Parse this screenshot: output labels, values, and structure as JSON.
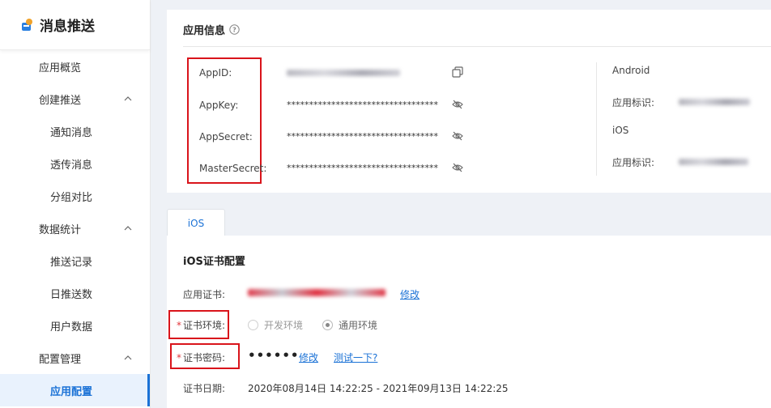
{
  "sidebar": {
    "title": "消息推送",
    "items": [
      {
        "label": "应用概览",
        "level": "top",
        "chevron": false
      },
      {
        "label": "创建推送",
        "level": "top",
        "chevron": true
      },
      {
        "label": "通知消息",
        "level": "sub",
        "chevron": false
      },
      {
        "label": "透传消息",
        "level": "sub",
        "chevron": false
      },
      {
        "label": "分组对比",
        "level": "sub",
        "chevron": false
      },
      {
        "label": "数据统计",
        "level": "top",
        "chevron": true
      },
      {
        "label": "推送记录",
        "level": "sub",
        "chevron": false
      },
      {
        "label": "日推送数",
        "level": "sub",
        "chevron": false
      },
      {
        "label": "用户数据",
        "level": "sub",
        "chevron": false
      },
      {
        "label": "配置管理",
        "level": "top",
        "chevron": true
      },
      {
        "label": "应用配置",
        "level": "sub",
        "chevron": false,
        "active": true
      }
    ]
  },
  "app_info": {
    "title": "应用信息",
    "fields": [
      {
        "label": "AppID:",
        "value": "",
        "masked": false
      },
      {
        "label": "AppKey:",
        "value": "**********************************",
        "masked": true
      },
      {
        "label": "AppSecret:",
        "value": "**********************************",
        "masked": true
      },
      {
        "label": "MasterSecret:",
        "value": "**********************************",
        "masked": true
      }
    ],
    "platforms": {
      "android_label": "Android",
      "android_id_label": "应用标识:",
      "ios_label": "iOS",
      "ios_id_label": "应用标识:"
    }
  },
  "tabs": [
    {
      "label": "iOS"
    }
  ],
  "ios_config": {
    "title": "iOS证书配置",
    "cert_label": "应用证书:",
    "cert_link": "修改",
    "env_label": "证书环境:",
    "env_options": [
      {
        "label": "开发环境",
        "checked": false
      },
      {
        "label": "通用环境",
        "checked": true
      }
    ],
    "password_label": "证书密码:",
    "password_value": "••••••",
    "modify_link": "修改",
    "test_link": "测试一下?",
    "date_label": "证书日期:",
    "date_value": "2020年08月14日 14:22:25 - 2021年09月13日 14:22:25"
  },
  "colors": {
    "accent": "#1b72d6",
    "highlight_box": "#d9141b",
    "required": "#e3353a"
  }
}
